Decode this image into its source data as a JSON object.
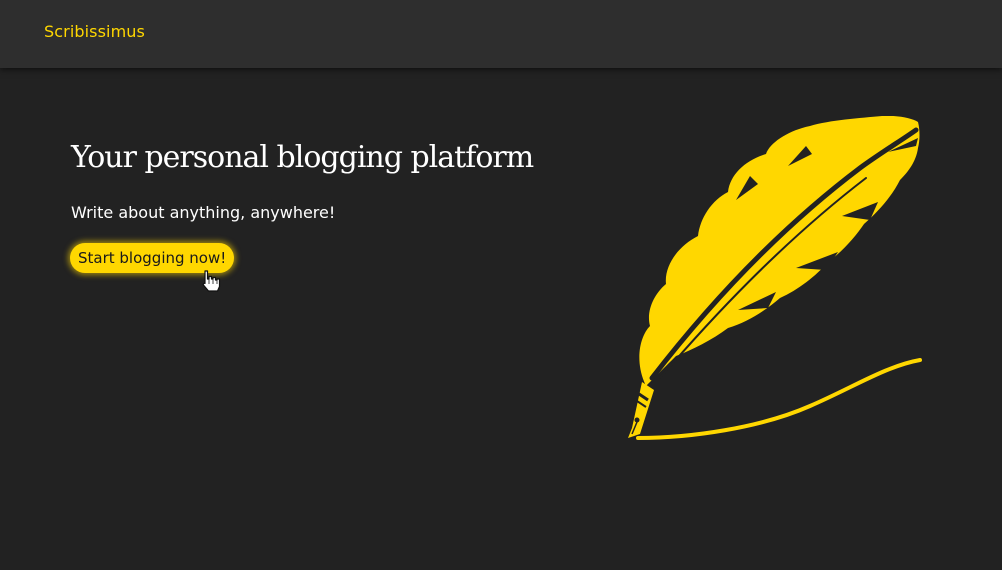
{
  "navbar": {
    "brand": "Scribissimus"
  },
  "hero": {
    "title": "Your personal blogging platform",
    "subtitle": "Write about anything, anywhere!",
    "cta_label": "Start blogging now!"
  },
  "colors": {
    "accent": "#ffd700",
    "background": "#222222",
    "navbar": "#2e2e2e",
    "text": "#ffffff"
  },
  "icons": {
    "illustration": "quill-pen-icon",
    "cursor": "hand-pointer-icon"
  }
}
